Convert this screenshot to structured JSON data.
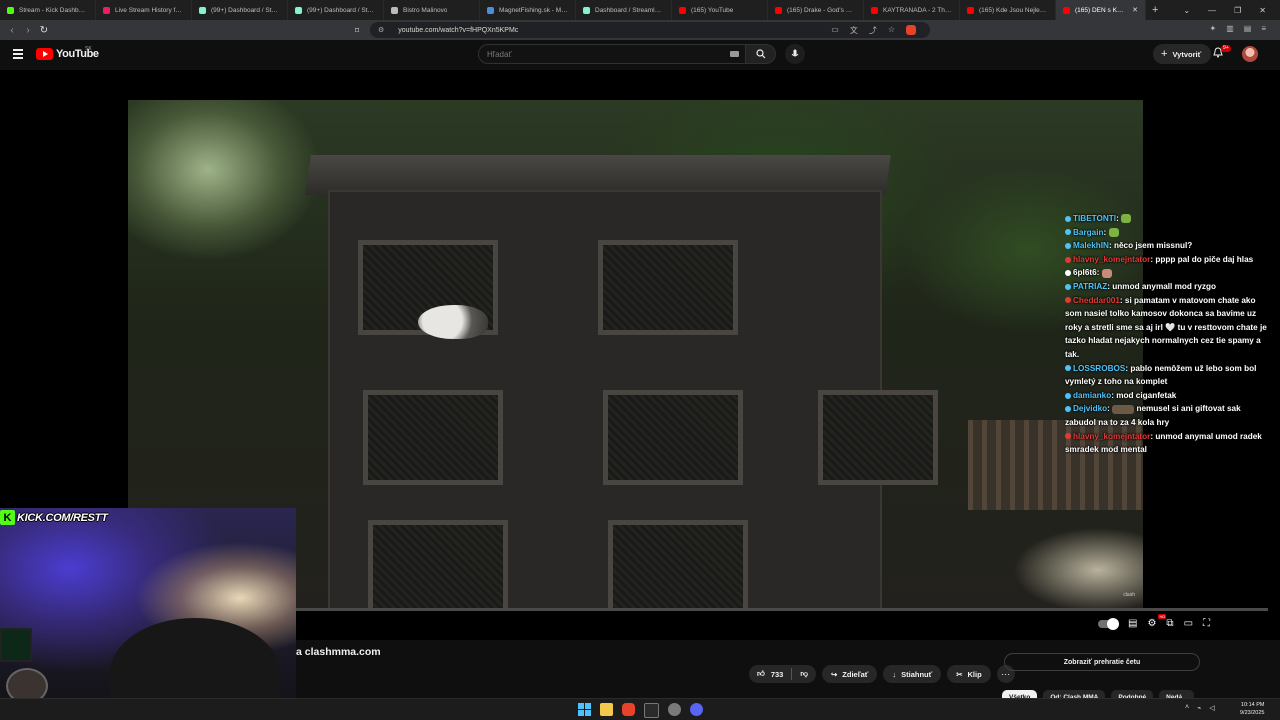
{
  "browser": {
    "tabs": [
      {
        "title": "Stream - Kick Dashboard",
        "color": "#53fc18",
        "active": false
      },
      {
        "title": "Live Stream History for Ble...",
        "color": "#e91e63",
        "active": false
      },
      {
        "title": "(99+) Dashboard / Streamla...",
        "color": "#80f5d2",
        "active": false
      },
      {
        "title": "(99+) Dashboard / Streamla...",
        "color": "#80f5d2",
        "active": false
      },
      {
        "title": "Bistro Malinovo",
        "color": "#bbbbbb",
        "active": false
      },
      {
        "title": "MagnetFishing.sk - Magnet...",
        "color": "#4a90e2",
        "active": false
      },
      {
        "title": "Dashboard / Streamlabs",
        "color": "#80f5d2",
        "active": false
      },
      {
        "title": "(165) YouTube",
        "color": "#ff0000",
        "active": false
      },
      {
        "title": "(165) Drake - God's Plan - Y...",
        "color": "#ff0000",
        "active": false
      },
      {
        "title": "KAYTRANADA - 2 The Mus...",
        "color": "#ff0000",
        "active": false
      },
      {
        "title": "(165) Kde Jsou Nejlepe Hory...",
        "color": "#ff0000",
        "active": false
      },
      {
        "title": "(165) DEN s KALIBOU",
        "color": "#ff0000",
        "active": true
      }
    ],
    "new_tab": "+",
    "url": "youtube.com/watch?v=fHPQXn5KPMc"
  },
  "youtube": {
    "logo_text": "YouTube",
    "country": "SK",
    "search_placeholder": "Hľadať",
    "create_label": "Vytvoriť",
    "notifications": "9+"
  },
  "player": {
    "progress_fraction": 0.0,
    "watermark": "clash",
    "kick_overlay": "KICK.COM/RESTT",
    "kick_letter": "K"
  },
  "chat": [
    {
      "user": "TIBETONTI",
      "user_color": "#4fc3f7",
      "text": "",
      "emote": "green"
    },
    {
      "user": "Bargain",
      "user_color": "#4fc3f7",
      "text": "",
      "emote": "green"
    },
    {
      "user": "MalekhIN",
      "user_color": "#4fc3f7",
      "text": "něco jsem missnul?",
      "emote": ""
    },
    {
      "user": "hlavny_komejntator",
      "user_color": "#e53935",
      "text": "pppp pal do piče daj hlas",
      "emote": ""
    },
    {
      "user": "6pl6t6",
      "user_color": "#ffffff",
      "text": "",
      "emote": "face"
    },
    {
      "user": "PATRIAZ",
      "user_color": "#4fc3f7",
      "text": "unmod anymall mod ryzgo",
      "emote": ""
    },
    {
      "user": "Cheddar001",
      "user_color": "#e53935",
      "text": "si pamatam v matovom chate ako som nasiel tolko kamosov dokonca sa bavime uz roky a stretli sme sa aj irl 🤍 tu v resttovom chate je tazko hladat nejakych normalnych cez tie spamy a tak.",
      "emote": ""
    },
    {
      "user": "LOSSROBOS",
      "user_color": "#4fc3f7",
      "text": "pablo nemôžem už lebo som bol vymletý z toho na komplet",
      "emote": ""
    },
    {
      "user": "damianko",
      "user_color": "#4fc3f7",
      "text": "mod ciganfetak",
      "emote": ""
    },
    {
      "user": "Dejvidko",
      "user_color": "#4fc3f7",
      "text": "nemusel si ani giftovat sak zabudol na to za 4 kola hry",
      "emote": "wide"
    },
    {
      "user": "hlavny_komejntator",
      "user_color": "#e53935",
      "text": "unmod anymal umod radek smradek mod mental",
      "emote": ""
    }
  ],
  "below": {
    "title": "a clashmma.com",
    "likes": "733",
    "share_label": "Zdieľať",
    "download_label": "Stiahnuť",
    "clip_label": "Klip",
    "chat_replay": "Zobraziť prehratie četu",
    "chips": [
      "Všetko",
      "Od: Clash MMA",
      "Podobné",
      "Nedá..."
    ]
  },
  "taskbar": {
    "time": "10:14 PM",
    "date": "9/23/2025"
  }
}
